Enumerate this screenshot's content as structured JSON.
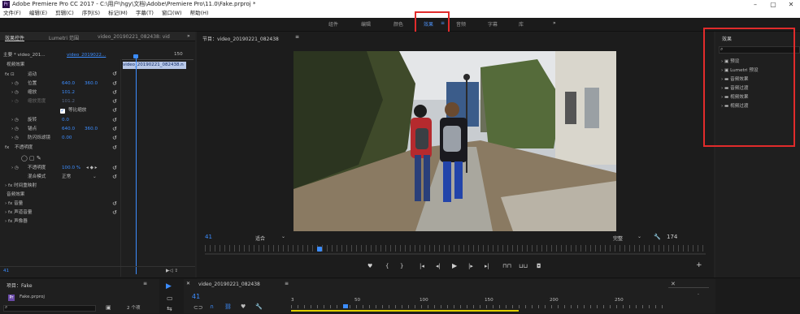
{
  "app": {
    "title": "Adobe Premiere Pro CC 2017 - C:\\用户\\hgy\\文档\\Adobe\\Premiere Pro\\11.0\\Fake.prproj *",
    "logo": "Pr",
    "menu": [
      "文件(F)",
      "编辑(E)",
      "剪辑(C)",
      "序列(S)",
      "标记(M)",
      "字幕(T)",
      "窗口(W)",
      "帮助(H)"
    ]
  },
  "workspaces": {
    "tabs": [
      "组件",
      "编辑",
      "颜色",
      "效果",
      "音频",
      "字幕",
      "库"
    ],
    "active": "效果",
    "more": "»",
    "menu_icon": "≡"
  },
  "effect_controls": {
    "tabs": [
      "效果控件",
      "Lumetri 范围",
      "video_20190221_082438: vid"
    ],
    "more": "»",
    "master": "主要 * video_201...",
    "clip": "video_2019022...",
    "timecode_end": "150",
    "clip_bar": "video_20190221_082438.n",
    "section_video": "视频效果",
    "section_audio": "音频效果",
    "motion": "运动",
    "params": [
      {
        "name": "位置",
        "v1": "640.0",
        "v2": "360.0"
      },
      {
        "name": "缩放",
        "v1": "101.2",
        "v2": ""
      },
      {
        "name": "缩放宽度",
        "v1": "101.2",
        "v2": "",
        "dim": true
      },
      {
        "name": "等比缩放",
        "v1": "",
        "v2": "",
        "checkbox": true
      },
      {
        "name": "旋转",
        "v1": "0.0",
        "v2": ""
      },
      {
        "name": "锚点",
        "v1": "640.0",
        "v2": "360.0"
      },
      {
        "name": "防闪烁滤镜",
        "v1": "0.00",
        "v2": ""
      }
    ],
    "opacity": "不透明度",
    "opacity_param": {
      "name": "不透明度",
      "value": "100.0 %"
    },
    "blend_mode_label": "混合模式",
    "blend_mode_value": "正常",
    "time_remap": "时间重映射",
    "audio_params": [
      "音量",
      "声道音量",
      "声像器"
    ],
    "bottom_timecode": "41"
  },
  "program": {
    "title": "节目：video_20190221_082438",
    "menu_icon": "≡",
    "timecode": "41",
    "fit": "适合",
    "quality": "完整",
    "duration": "174",
    "add": "+"
  },
  "effects_panel": {
    "title": "效果",
    "search_placeholder": "",
    "items": [
      "预设",
      "Lumetri 预设",
      "音频效果",
      "音频过渡",
      "视频效果",
      "视频过渡"
    ]
  },
  "project": {
    "title": "项目：Fake",
    "file": "Fake.prproj",
    "count": "2 个项"
  },
  "timeline": {
    "title": "video_20190221_082438",
    "timecode": "41",
    "ruler": [
      "0",
      "50",
      "100",
      "150",
      "200",
      "250"
    ],
    "ruler_start": "3"
  }
}
